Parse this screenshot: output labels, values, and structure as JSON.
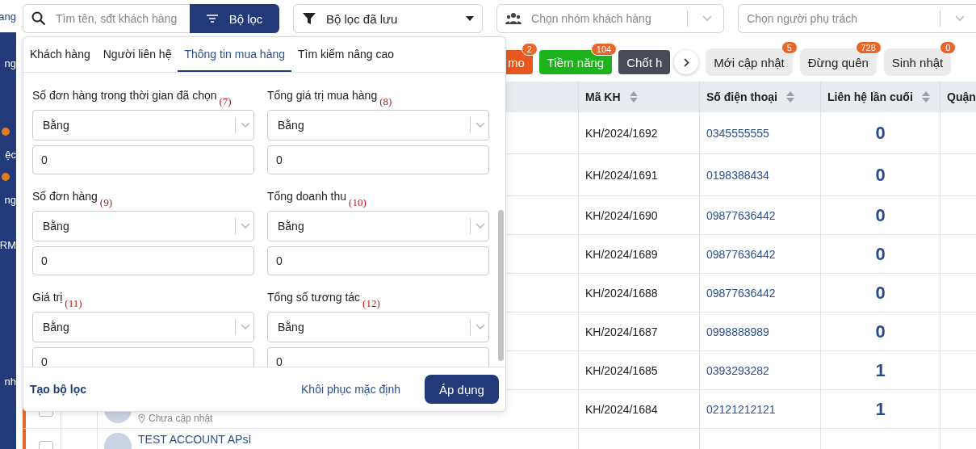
{
  "sidebar": {
    "top_label": "ang",
    "items": [
      {
        "label": "ng",
        "dot": false
      },
      {
        "label": "ệc",
        "dot": true
      },
      {
        "label": "ng",
        "dot": true
      },
      {
        "label": "RM",
        "dot": false
      },
      {
        "label": "nh",
        "dot": false
      }
    ]
  },
  "toolbar": {
    "search": {
      "placeholder": "Tìm tên, sđt khách hàng"
    },
    "filter_button": "Bộ lọc",
    "saved_filters": "Bộ lọc đã lưu",
    "group_select": {
      "placeholder": "Chọn nhóm khách hàng"
    },
    "owner_select": {
      "placeholder": "Chọn người phụ trách"
    }
  },
  "status_tags": [
    {
      "label": "mo",
      "count": "2",
      "color": "#e8571e"
    },
    {
      "label": "Tiềm năng",
      "count": "104",
      "color": "#1db31d"
    },
    {
      "label": "Chốt h",
      "color": "#474a57"
    }
  ],
  "quick_filters": [
    {
      "label": "Mới cập nhật",
      "count": "5"
    },
    {
      "label": "Đừng quên",
      "count": "728"
    },
    {
      "label": "Sinh nhật",
      "count": "0"
    }
  ],
  "table": {
    "columns": [
      {
        "label": "Mã KH",
        "sort": true
      },
      {
        "label": "Số điện thoại",
        "sort": true
      },
      {
        "label": "Liên hệ lần cuối",
        "sort": true
      },
      {
        "label": "Quận"
      }
    ],
    "rows": [
      {
        "code": "KH/2024/1692",
        "phone": "0345555555",
        "last_contact": "0"
      },
      {
        "code": "KH/2024/1691",
        "phone": "0198388434",
        "last_contact": "0"
      },
      {
        "code": "KH/2024/1690",
        "phone": "09877636442",
        "last_contact": "0"
      },
      {
        "code": "KH/2024/1689",
        "phone": "09877636442",
        "last_contact": "0"
      },
      {
        "code": "KH/2024/1688",
        "phone": "09877636442",
        "last_contact": "0"
      },
      {
        "code": "KH/2024/1687",
        "phone": "0998888989",
        "last_contact": "0"
      },
      {
        "code": "KH/2024/1685",
        "phone": "0393293282",
        "last_contact": "1"
      },
      {
        "code": "KH/2024/1684",
        "phone": "02121212121",
        "last_contact": "1",
        "marked": true,
        "checked": false,
        "address": "Chưa cập nhật"
      },
      {
        "marked": true,
        "checked": false,
        "name": "TEST ACCOUNT APsI"
      }
    ]
  },
  "filter_panel": {
    "tabs": [
      {
        "label": "Khách hàng",
        "selected": false
      },
      {
        "label": "Người liên hệ",
        "selected": false
      },
      {
        "label": "Thông tin mua hàng",
        "selected": true
      },
      {
        "label": "Tìm kiếm nâng cao",
        "selected": false
      }
    ],
    "fields": [
      {
        "label": "Số đơn hàng trong thời gian đã chọn",
        "note": "(7)",
        "operator": "Bằng",
        "value": "0"
      },
      {
        "label": "Tổng giá trị mua hàng",
        "note": "(8)",
        "operator": "Bằng",
        "value": "0"
      },
      {
        "label": "Số đơn hàng",
        "note": "(9)",
        "operator": "Bằng",
        "value": "0"
      },
      {
        "label": "Tổng doanh thu",
        "note": "(10)",
        "operator": "Bằng",
        "value": "0"
      },
      {
        "label": "Giá trị",
        "note": "(11)",
        "operator": "Bằng",
        "value": "0"
      },
      {
        "label": "Tổng số tương tác",
        "note": "(12)",
        "operator": "Bằng",
        "value": "0"
      }
    ],
    "create_link": "Tạo bộ lọc",
    "reset_button": "Khôi phục mặc định",
    "apply_button": "Áp dụng"
  }
}
